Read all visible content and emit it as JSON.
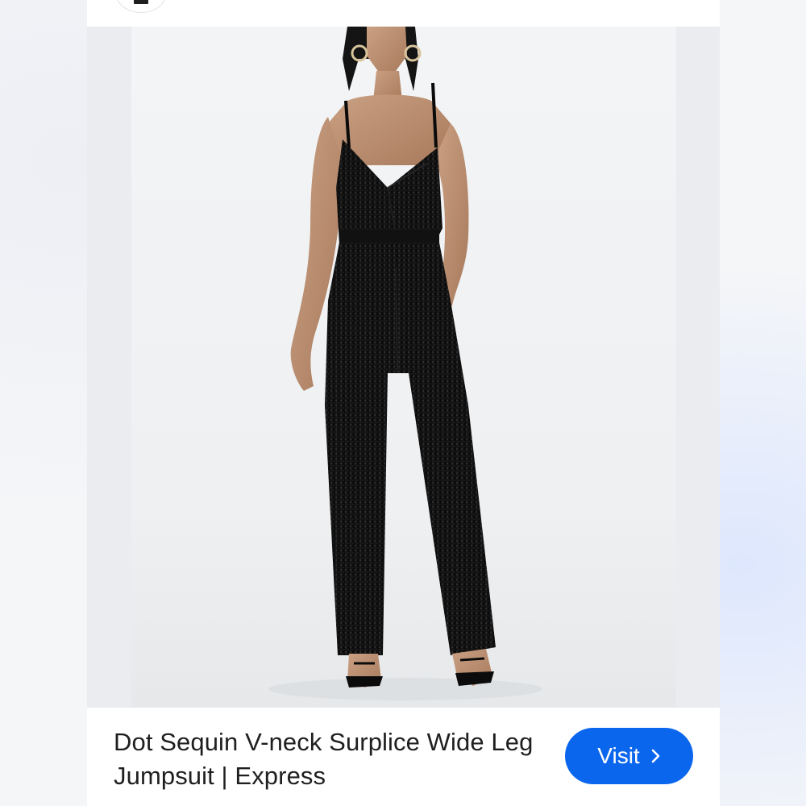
{
  "source": {
    "icon": "express-logo-icon"
  },
  "image": {
    "subject": "model-wearing-black-sequin-jumpsuit"
  },
  "product": {
    "title": "Dot Sequin V-neck Surplice Wide Leg Jumpsuit | Express",
    "subtitle": ""
  },
  "actions": {
    "visit_label": "Visit",
    "visit_icon": "chevron-right-icon",
    "button_color": "#0b66ee"
  }
}
